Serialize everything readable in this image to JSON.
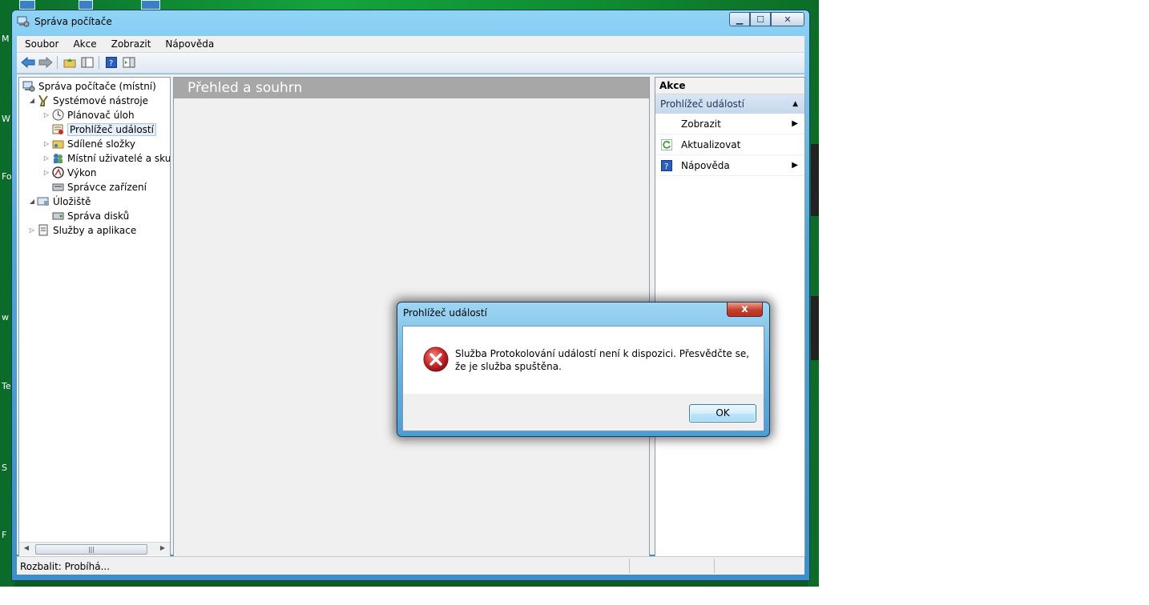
{
  "window": {
    "title": "Správa počítače",
    "caption_minimize": "▁",
    "caption_maximize": "☐",
    "caption_close": "✕"
  },
  "menu": [
    "Soubor",
    "Akce",
    "Zobrazit",
    "Nápověda"
  ],
  "tree": {
    "items": [
      {
        "label": "Správa počítače (místní)",
        "icon": "computer-management-icon"
      },
      {
        "label": "Systémové nástroje",
        "icon": "system-tools-icon"
      },
      {
        "label": "Plánovač úloh",
        "icon": "task-scheduler-icon"
      },
      {
        "label": "Prohlížeč událostí",
        "icon": "event-viewer-icon"
      },
      {
        "label": "Sdílené složky",
        "icon": "shared-folders-icon"
      },
      {
        "label": "Místní uživatelé a skupiny",
        "icon": "users-groups-icon"
      },
      {
        "label": "Výkon",
        "icon": "performance-icon"
      },
      {
        "label": "Správce zařízení",
        "icon": "device-manager-icon"
      },
      {
        "label": "Úložiště",
        "icon": "storage-icon"
      },
      {
        "label": "Správa disků",
        "icon": "disk-management-icon"
      },
      {
        "label": "Služby a aplikace",
        "icon": "services-apps-icon"
      }
    ]
  },
  "center": {
    "header": "Přehled a souhrn"
  },
  "actions": {
    "title": "Akce",
    "section": "Prohlížeč událostí",
    "items": [
      {
        "label": "Zobrazit",
        "icon": "",
        "has_submenu": true
      },
      {
        "label": "Aktualizovat",
        "icon": "refresh-icon",
        "has_submenu": false
      },
      {
        "label": "Nápověda",
        "icon": "help-icon",
        "has_submenu": true
      }
    ]
  },
  "status": {
    "text": "Rozbalit:  Probíhá..."
  },
  "dialog": {
    "title": "Prohlížeč událostí",
    "message": "Služba Protokolování událostí není k dispozici. Přesvědčte se, že je služba spuštěna.",
    "ok_label": "OK",
    "close_label": "x"
  },
  "colors": {
    "desktop_green": "#14a43d",
    "window_frame": "#4fa6dc",
    "center_header_bg": "#a7a7a7",
    "actions_section_bg": "#c6d8ec",
    "dialog_close_red": "#c2402b",
    "error_red": "#d1282b"
  },
  "desktop": {
    "glyphs": [
      "M",
      "W",
      "Fo",
      "w",
      "Te",
      "S",
      "F"
    ]
  }
}
